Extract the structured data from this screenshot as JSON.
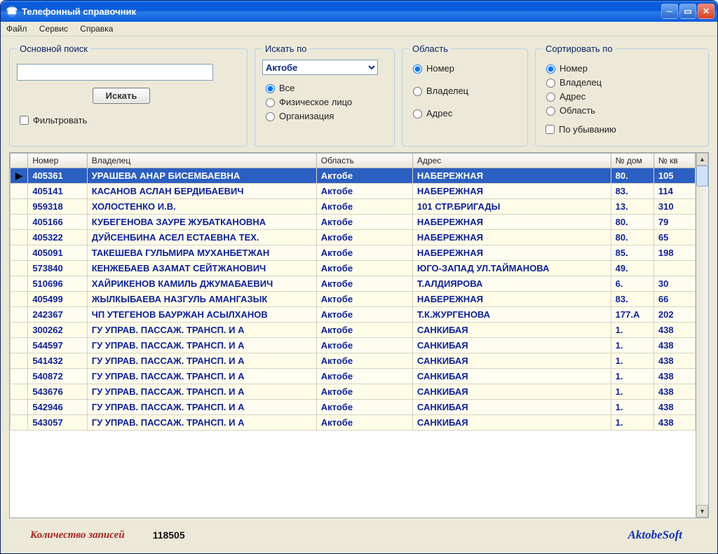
{
  "window": {
    "title": "Телефонный справочник"
  },
  "menu": {
    "file": "Файл",
    "service": "Сервис",
    "help": "Справка"
  },
  "groups": {
    "search": {
      "legend": "Основной поиск",
      "button": "Искать",
      "filter": "Фильтровать",
      "value": ""
    },
    "searchby": {
      "legend": "Искать по",
      "region_selected": "Актобе",
      "opt_all": "Все",
      "opt_person": "Физическое лицо",
      "opt_org": "Организация"
    },
    "region": {
      "legend": "Область",
      "opt_number": "Номер",
      "opt_owner": "Владелец",
      "opt_address": "Адрес"
    },
    "sort": {
      "legend": "Сортировать по",
      "opt_number": "Номер",
      "opt_owner": "Владелец",
      "opt_address": "Адрес",
      "opt_region": "Область",
      "desc": "По убыванию"
    }
  },
  "table": {
    "headers": {
      "number": "Номер",
      "owner": "Владелец",
      "region": "Область",
      "address": "Адрес",
      "house": "№ дом",
      "apt": "№ кв"
    },
    "rows": [
      {
        "num": "405361",
        "owner": "УРАШЕВА АНАР БИСЕМБАЕВНА",
        "region": "Актобе",
        "addr": "НАБЕРЕЖНАЯ",
        "house": "80.",
        "apt": "105"
      },
      {
        "num": "405141",
        "owner": "КАСАНОВ АСЛАН БЕРДИБАЕВИЧ",
        "region": "Актобе",
        "addr": "НАБЕРЕЖНАЯ",
        "house": "83.",
        "apt": "114"
      },
      {
        "num": "959318",
        "owner": "ХОЛОСТЕНКО И.В.",
        "region": "Актобе",
        "addr": "101 СТР.БРИГАДЫ",
        "house": "13.",
        "apt": "310"
      },
      {
        "num": "405166",
        "owner": "КУБЕГЕНОВА ЗАУРЕ ЖУБАТКАНОВНА",
        "region": "Актобе",
        "addr": "НАБЕРЕЖНАЯ",
        "house": "80.",
        "apt": "79"
      },
      {
        "num": "405322",
        "owner": "ДУЙСЕНБИНА АСЕЛ ЕСТАЕВНА ТЕХ.",
        "region": "Актобе",
        "addr": "НАБЕРЕЖНАЯ",
        "house": "80.",
        "apt": "65"
      },
      {
        "num": "405091",
        "owner": "ТАКЕШЕВА ГУЛЬМИРА МУХАНБЕТЖАН",
        "region": "Актобе",
        "addr": "НАБЕРЕЖНАЯ",
        "house": "85.",
        "apt": "198"
      },
      {
        "num": "573840",
        "owner": "КЕНЖЕБАЕВ АЗАМАТ СЕЙТЖАНОВИЧ",
        "region": "Актобе",
        "addr": "ЮГО-ЗАПАД УЛ.ТАЙМАНОВА",
        "house": "49.",
        "apt": ""
      },
      {
        "num": "510696",
        "owner": "ХАЙРИКЕНОВ КАМИЛЬ ДЖУМАБАЕВИЧ",
        "region": "Актобе",
        "addr": "Т.АЛДИЯРОВА",
        "house": "6.",
        "apt": "30"
      },
      {
        "num": "405499",
        "owner": "ЖЫЛКЫБАЕВА НАЗГУЛЬ АМАНГАЗЫК",
        "region": "Актобе",
        "addr": "НАБЕРЕЖНАЯ",
        "house": "83.",
        "apt": "66"
      },
      {
        "num": "242367",
        "owner": "ЧП УТЕГЕНОВ БАУРЖАН АСЫЛХАНОВ",
        "region": "Актобе",
        "addr": "Т.К.ЖУРГЕНОВА",
        "house": "177.А",
        "apt": "202"
      },
      {
        "num": "300262",
        "owner": "ГУ  УПРАВ. ПАССАЖ. ТРАНСП. И А",
        "region": "Актобе",
        "addr": "САНКИБАЯ",
        "house": "1.",
        "apt": "438"
      },
      {
        "num": "544597",
        "owner": "ГУ  УПРАВ. ПАССАЖ. ТРАНСП. И А",
        "region": "Актобе",
        "addr": "САНКИБАЯ",
        "house": "1.",
        "apt": "438"
      },
      {
        "num": "541432",
        "owner": "ГУ  УПРАВ. ПАССАЖ. ТРАНСП. И А",
        "region": "Актобе",
        "addr": "САНКИБАЯ",
        "house": "1.",
        "apt": "438"
      },
      {
        "num": "540872",
        "owner": "ГУ  УПРАВ. ПАССАЖ. ТРАНСП. И А",
        "region": "Актобе",
        "addr": "САНКИБАЯ",
        "house": "1.",
        "apt": "438"
      },
      {
        "num": "543676",
        "owner": "ГУ  УПРАВ. ПАССАЖ. ТРАНСП. И А",
        "region": "Актобе",
        "addr": "САНКИБАЯ",
        "house": "1.",
        "apt": "438"
      },
      {
        "num": "542946",
        "owner": "ГУ  УПРАВ. ПАССАЖ. ТРАНСП. И А",
        "region": "Актобе",
        "addr": "САНКИБАЯ",
        "house": "1.",
        "apt": "438"
      },
      {
        "num": "543057",
        "owner": "ГУ  УПРАВ. ПАССАЖ. ТРАНСП. И А",
        "region": "Актобе",
        "addr": "САНКИБАЯ",
        "house": "1.",
        "apt": "438"
      }
    ]
  },
  "footer": {
    "label": "Количество записей",
    "count": "118505",
    "brand": "AktobeSoft"
  }
}
